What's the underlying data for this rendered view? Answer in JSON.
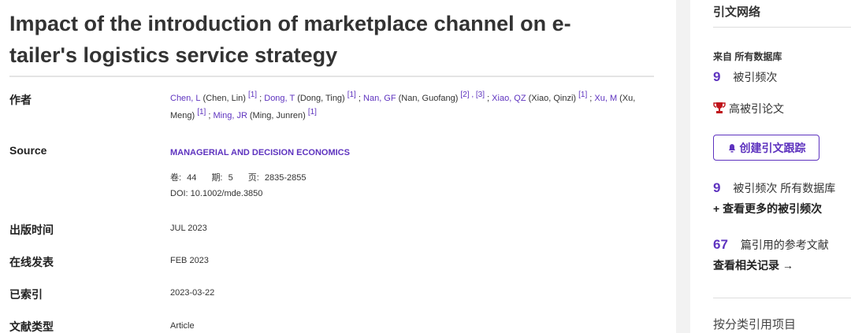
{
  "record": {
    "title_line1": "Impact of the introduction of marketplace channel on e-",
    "title_line2": "tailer's logistics service strategy",
    "labels": {
      "authors": "作者",
      "source": "Source",
      "pub_date": "出版时间",
      "online": "在线发表",
      "indexed": "已索引",
      "doc_type": "文献类型"
    },
    "authors": [
      {
        "short": "Chen, L",
        "full": "(Chen, Lin)",
        "refs": "[1]",
        "sep": " ; "
      },
      {
        "short": "Dong, T",
        "full": "(Dong, Ting)",
        "refs": "[1]",
        "sep": " ; "
      },
      {
        "short": "Nan, GF",
        "full": "(Nan, Guofang)",
        "refs": "[2] , [3]",
        "sep": " ; "
      },
      {
        "short": "Xiao, QZ",
        "full": "(Xiao, Qinzi)",
        "refs": "[1]",
        "sep": " ; "
      },
      {
        "short": "Xu, M",
        "full": "(Xu, Meng)",
        "refs": "[1]",
        "sep": " ; "
      },
      {
        "short": "Ming, JR",
        "full": "(Ming, Junren)",
        "refs": "[1]",
        "sep": ""
      }
    ],
    "journal": "MANAGERIAL AND DECISION ECONOMICS",
    "volume_label": "卷:",
    "volume": "44",
    "issue_label": "期:",
    "issue": "5",
    "pages_label": "页:",
    "pages": "2835-2855",
    "doi": "DOI: 10.1002/mde.3850",
    "pub_date": "JUL 2023",
    "online": "FEB 2023",
    "indexed": "2023-03-22",
    "doc_type": "Article"
  },
  "sidebar": {
    "title": "引文网络",
    "from_label": "来自 所有数据库",
    "times_cited_num": "9",
    "times_cited_label": "被引频次",
    "highly_cited": "高被引论文",
    "create_alert": "创建引文跟踪",
    "all_db_num": "9",
    "all_db_label": "被引频次 所有数据库",
    "see_more": "+ 查看更多的被引频次",
    "refs_num": "67",
    "refs_label": "篇引用的参考文献",
    "related": "查看相关记录 →",
    "classify": "按分类引用项目"
  },
  "colors": {
    "accent": "#5e33bf",
    "trophy": "#c0141b"
  }
}
